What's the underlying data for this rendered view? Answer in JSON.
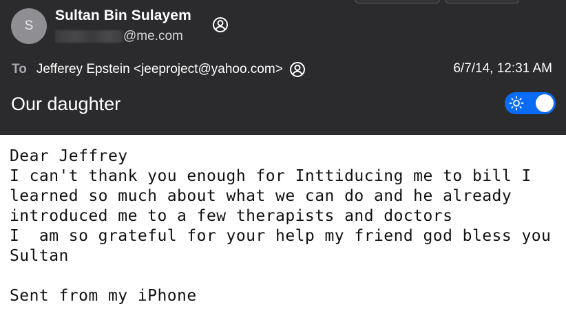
{
  "header": {
    "avatar_initial": "S",
    "sender_name": "Sultan Bin Sulayem",
    "sender_email_domain": "@me.com",
    "to_label": "To",
    "to_value": "Jefferey Epstein <jeeproject@yahoo.com>",
    "date": "6/7/14, 12:31 AM",
    "subject": "Our daughter",
    "toggle_on": true,
    "accent_color": "#0a6cf5"
  },
  "body": {
    "lines": [
      "Dear Jeffrey",
      "I can't thank you enough for Inttiducing me to bill I",
      "learned so much about what we can do and he already",
      "introduced me to a few therapists and doctors",
      "I  am so grateful for your help my friend god bless you",
      "Sultan",
      "",
      "Sent from my iPhone"
    ]
  }
}
